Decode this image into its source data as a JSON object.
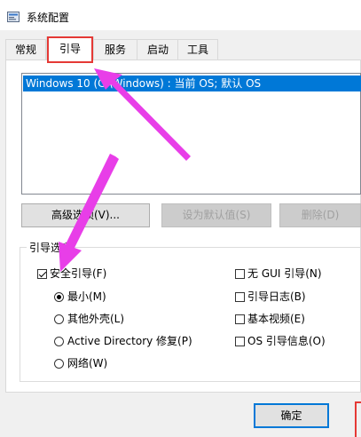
{
  "window": {
    "title": "系统配置"
  },
  "tabs": [
    {
      "label": "常规",
      "active": false
    },
    {
      "label": "引导",
      "active": true
    },
    {
      "label": "服务",
      "active": false
    },
    {
      "label": "启动",
      "active": false
    },
    {
      "label": "工具",
      "active": false
    }
  ],
  "boot_list": {
    "entries": [
      "Windows 10 (C:\\Windows) : 当前 OS; 默认 OS"
    ]
  },
  "buttons": {
    "advanced": "高级选项(V)...",
    "set_default": "设为默认值(S)",
    "delete": "删除(D)",
    "ok": "确定"
  },
  "boot_options": {
    "legend": "引导选项",
    "safe_boot": "安全引导(F)",
    "minimal": "最小(M)",
    "alternate_shell": "其他外壳(L)",
    "active_directory_repair": "Active Directory 修复(P)",
    "network": "网络(W)",
    "no_gui_boot": "无 GUI 引导(N)",
    "boot_log": "引导日志(B)",
    "base_video": "基本视频(E)",
    "os_boot_info": "OS 引导信息(O)"
  },
  "annotation_colors": {
    "arrow": "#e83ee8",
    "highlight_box": "#e53935",
    "selection": "#0078d7"
  }
}
